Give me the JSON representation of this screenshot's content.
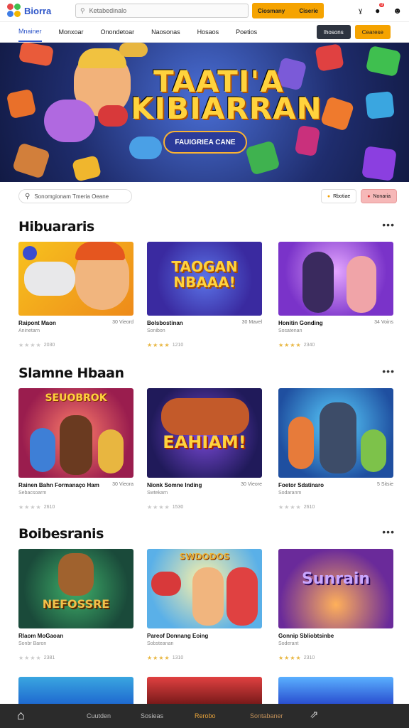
{
  "header": {
    "brand": "Biorra",
    "search_placeholder": "Ketabedinalo",
    "cta_label": "Ciosmany",
    "cta_value": "Ciserie",
    "icon_badge": "8"
  },
  "nav": {
    "items": [
      "Mnainer",
      "Monxoar",
      "Onondetoar",
      "Naosonas",
      "Hosaos",
      "Poetios"
    ],
    "btn_dark": "Ihosons",
    "btn_orange": "Cearese"
  },
  "hero": {
    "title_line1": "TAATI'A",
    "title_line2": "KIBIARRAN",
    "subtitle": "FAUIGRIEA CANE"
  },
  "filters": {
    "search_text": "Sonomgionam Tmeria  Oeane",
    "chip1": "Rbotiae",
    "chip2": "Nonaria"
  },
  "sections": [
    {
      "title": "Hibuararis",
      "cards": [
        {
          "title": "Raipont Maon",
          "count": "30 Vieord",
          "sub": "Aninetarn",
          "rating": "2030",
          "thumb_text": ""
        },
        {
          "title": "Bolsbostinan",
          "count": "30 Mavel",
          "sub": "Sonibon",
          "rating": "1210",
          "thumb_text": "TAOGAN NBAAA!"
        },
        {
          "title": "Honitin Gonding",
          "count": "34 Voins",
          "sub": "Sosatenan",
          "rating": "2340",
          "thumb_text": ""
        }
      ]
    },
    {
      "title": "Slamne Hbaan",
      "cards": [
        {
          "title": "Rainen Bahn Formanaço Ham",
          "count": "30 Vieora",
          "sub": "Sebacsoarm",
          "rating": "2610",
          "thumb_text": "SEUOBROK"
        },
        {
          "title": "Nionk Somne Inding",
          "count": "30 Vieore",
          "sub": "Swtekarn",
          "rating": "1530",
          "thumb_text": "EAHIAM!"
        },
        {
          "title": "Foetor Sdatinaro",
          "count": "5 Sitsie",
          "sub": "Sodaranm",
          "rating": "2610",
          "thumb_text": ""
        }
      ]
    },
    {
      "title": "Boibesranis",
      "cards": [
        {
          "title": "Rlaom MoGaoan",
          "count": "",
          "sub": "Sonbr Baron",
          "rating": "2381",
          "thumb_text": "NEFOSSRE"
        },
        {
          "title": "Pareof Donnang Eoing",
          "count": "",
          "sub": "Sobsteanan",
          "rating": "1310",
          "thumb_text": "SWDODOS"
        },
        {
          "title": "Gonnip Sbliobtsinbe",
          "count": "",
          "sub": "Soderant",
          "rating": "2310",
          "thumb_text": "Sunrain"
        }
      ]
    }
  ],
  "bottom_nav": {
    "items": [
      "Cuutden",
      "Sosieas",
      "Rerobo",
      "Sontabaner"
    ]
  },
  "colors": {
    "accent": "#2d55c8",
    "cta": "#f5a300",
    "bottom_bar": "#2b2b2b"
  }
}
